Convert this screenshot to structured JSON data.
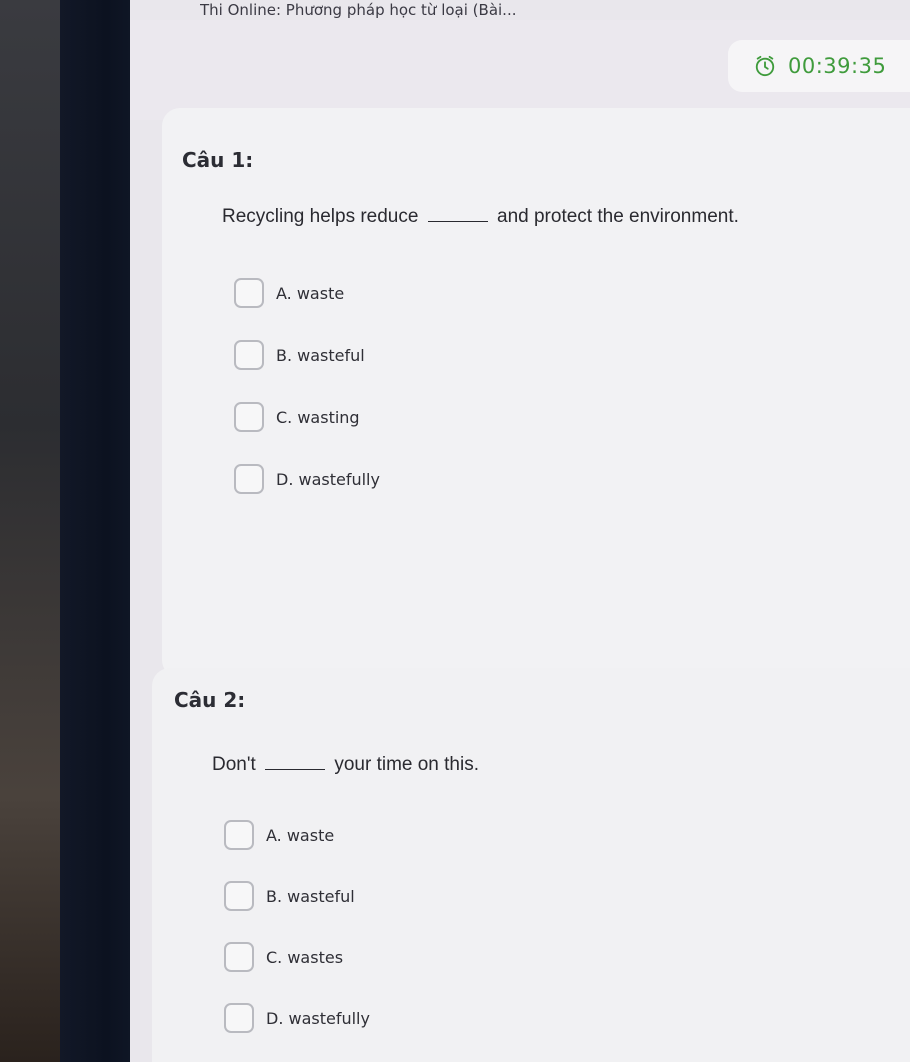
{
  "window": {
    "title": "Thi Online: Phương pháp học từ loại (Bài..."
  },
  "timer": {
    "value": "00:39:35",
    "icon": "alarm-clock-icon",
    "color": "#3f9b3c"
  },
  "questions": [
    {
      "title": "Câu 1:",
      "text_before": "Recycling helps reduce",
      "text_after": "and protect the environment.",
      "options": [
        {
          "label": "A. waste"
        },
        {
          "label": "B. wasteful"
        },
        {
          "label": "C. wasting"
        },
        {
          "label": "D. wastefully"
        }
      ]
    },
    {
      "title": "Câu 2:",
      "text_before": "Don't",
      "text_after": "your time on this.",
      "options": [
        {
          "label": "A. waste"
        },
        {
          "label": "B. wasteful"
        },
        {
          "label": "C. wastes"
        },
        {
          "label": "D. wastefully"
        }
      ]
    }
  ]
}
